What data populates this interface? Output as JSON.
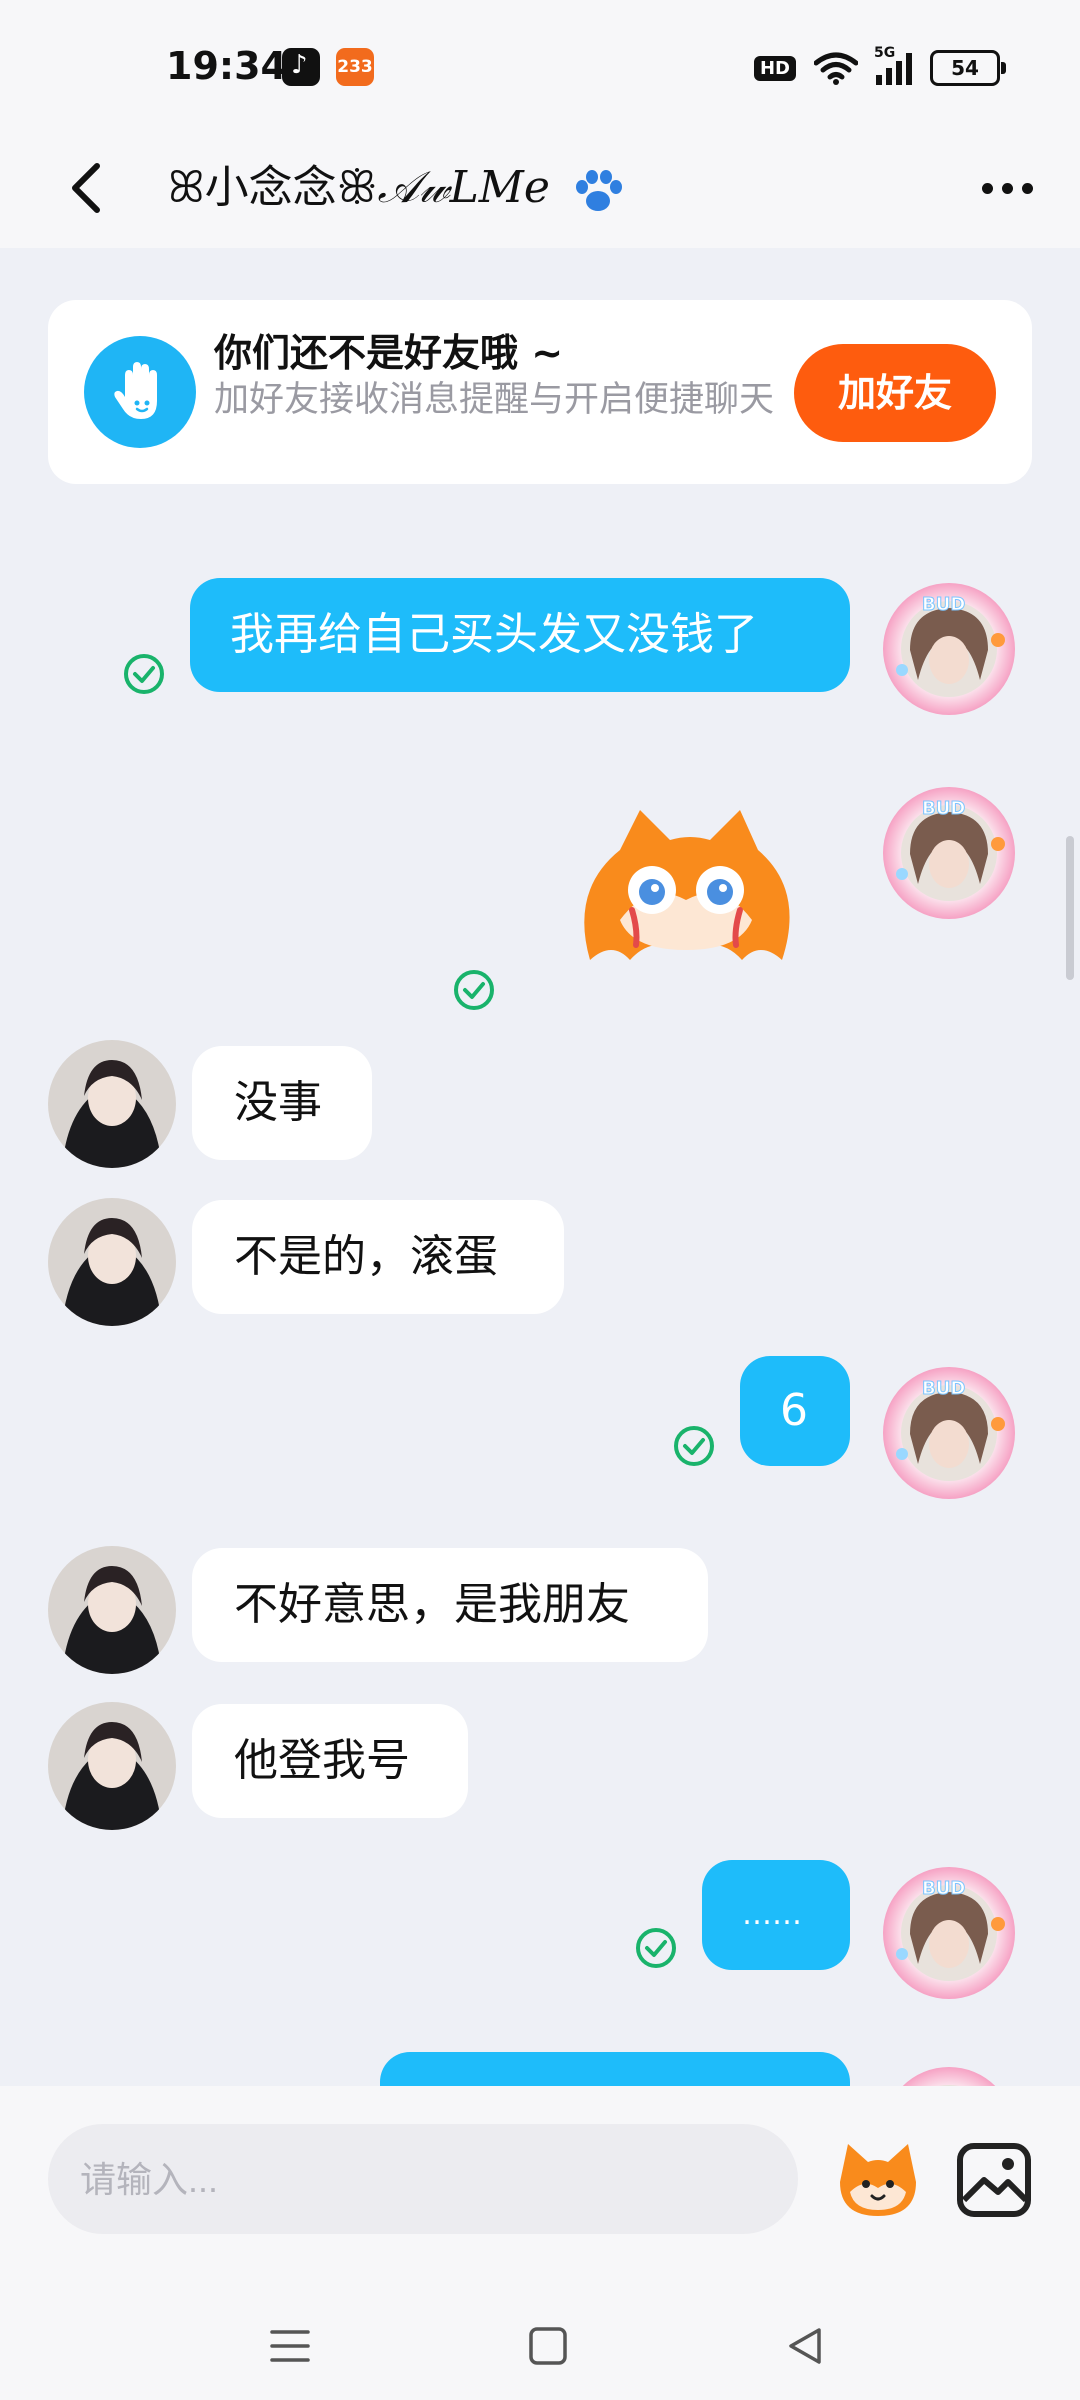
{
  "status_bar": {
    "time": "19:34",
    "app_badge": "233",
    "hd": "HD",
    "network": "5G",
    "battery": "54"
  },
  "header": {
    "title_prefix": "ꕤ小念念ꕥ",
    "title_fancy": "𝒜𝓌𝐿𝑀𝑒",
    "icons": [
      "back-icon",
      "paw-icon",
      "more-icon"
    ]
  },
  "friend_card": {
    "title": "你们还不是好友哦 ~",
    "subtitle": "加好友接收消息提醒与开启便捷聊天",
    "button": "加好友"
  },
  "messages": [
    {
      "from": "me",
      "text": "我再给自己买头发又没钱了",
      "status": "read"
    },
    {
      "from": "me",
      "type": "sticker",
      "sticker": "crying-fox-sticker",
      "status": "read"
    },
    {
      "from": "them",
      "text": "没事"
    },
    {
      "from": "them",
      "text": "不是的，滚蛋"
    },
    {
      "from": "me",
      "text": "6",
      "status": "read"
    },
    {
      "from": "them",
      "text": "不好意思，是我朋友"
    },
    {
      "from": "them",
      "text": "他登我号"
    },
    {
      "from": "me",
      "text": "……",
      "status": "read"
    }
  ],
  "input": {
    "placeholder": "请输入..."
  },
  "colors": {
    "accent_blue": "#1ebcfa",
    "add_button": "#fe5c0e",
    "check_green": "#19b36b",
    "background": "#eef0f6"
  }
}
